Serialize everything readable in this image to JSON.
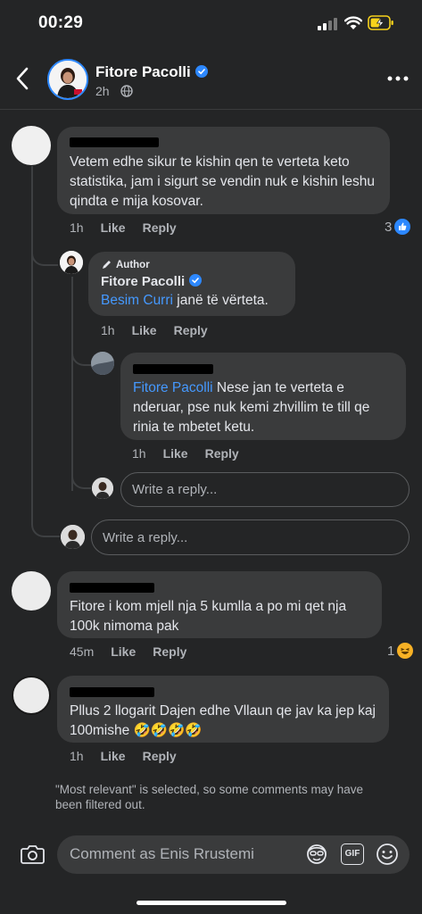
{
  "status_bar": {
    "time": "00:29"
  },
  "header": {
    "name": "Fitore Pacolli",
    "time": "2h"
  },
  "comments": [
    {
      "id": "besim",
      "text": "Vetem edhe sikur te kishin qen te verteta keto statistika, jam i sigurt se vendin nuk e kishin leshu qindta e mija kosovar.",
      "time": "1h",
      "like": "Like",
      "reply": "Reply",
      "reaction_count": "3",
      "reaction_type": "like-icon"
    },
    {
      "id": "fitore-reply",
      "badge": "Author",
      "name": "Fitore Pacolli",
      "mention": "Besim Curri",
      "text": " janë të vërteta.",
      "time": "1h",
      "like": "Like",
      "reply": "Reply"
    },
    {
      "id": "besim-reply",
      "mention": "Fitore Pacolli",
      "text": " Nese jan te verteta e nderuar, pse nuk kemi zhvillim te till qe rinia te mbetet ketu.",
      "time": "1h",
      "like": "Like",
      "reply": "Reply"
    },
    {
      "id": "comment-3",
      "text": "Fitore i kom mjell nja 5 kumlla a po mi qet nja 100k nimoma pak",
      "time": "45m",
      "like": "Like",
      "reply": "Reply",
      "reaction_count": "1",
      "reaction_type": "haha-icon"
    },
    {
      "id": "comment-4",
      "text": "Pllus 2 llogarit Dajen edhe Vllaun qe jav ka jep kaj 100mishe 🤣🤣🤣🤣",
      "time": "1h",
      "like": "Like",
      "reply": "Reply"
    }
  ],
  "reply_placeholder": "Write a reply...",
  "notice": "\"Most relevant\" is selected, so some comments may have been filtered out.",
  "composer": {
    "placeholder": "Comment as Enis Rrustemi",
    "gif_label": "GIF"
  },
  "colors": {
    "background": "#242526",
    "bubble": "#3a3b3c",
    "accent": "#2d88ff",
    "mention": "#4599ff"
  }
}
